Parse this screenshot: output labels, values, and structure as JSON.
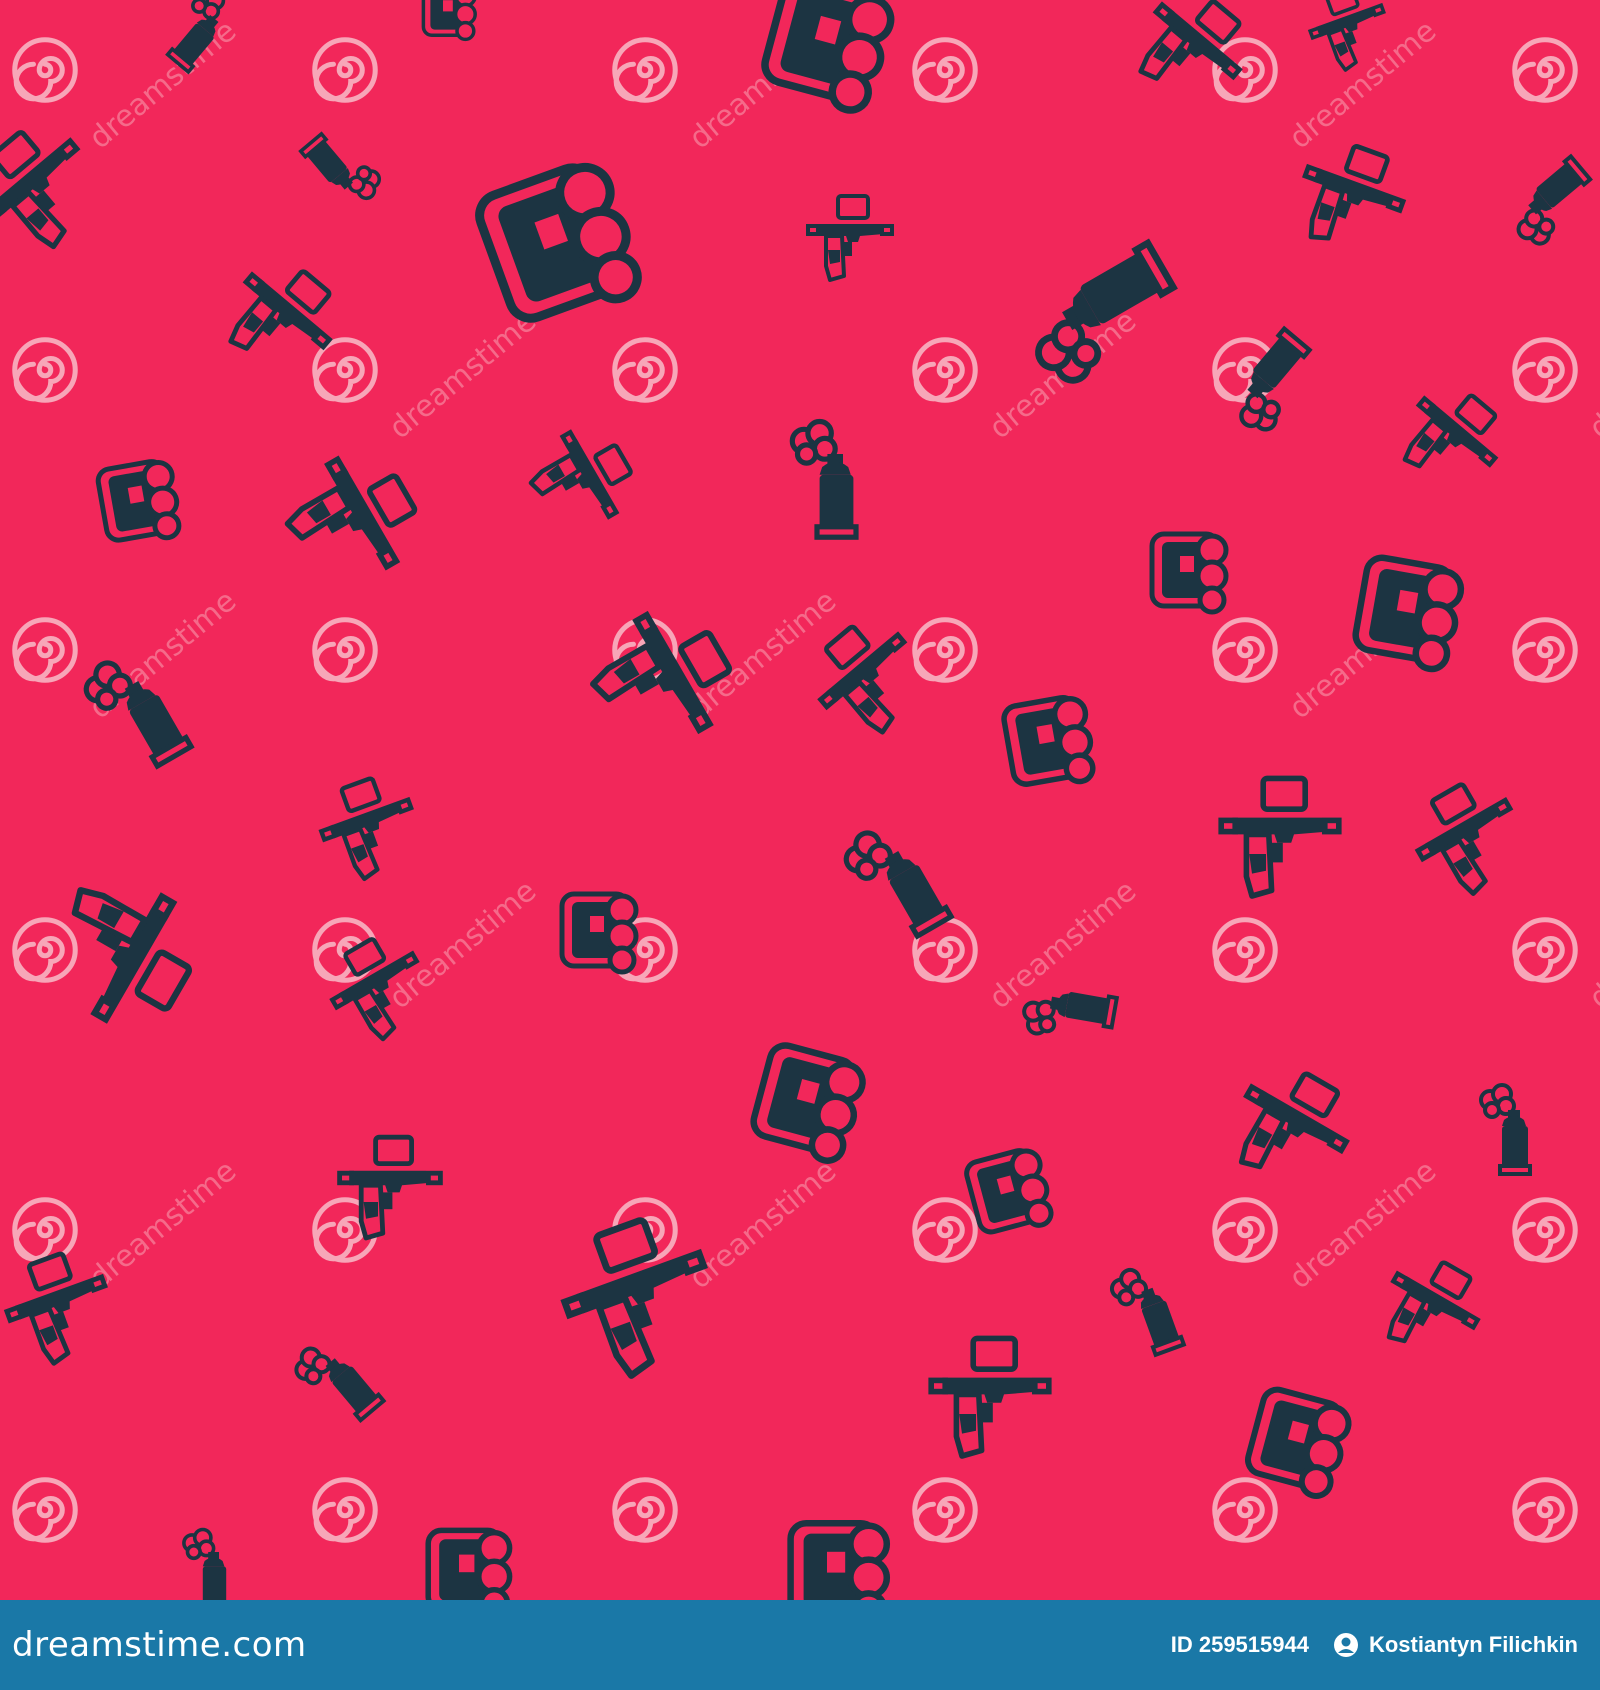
{
  "colors": {
    "background": "#f2275a",
    "icons": "#1c3442",
    "footer": "#1a78a7",
    "watermark_logo": "#f7a6b8",
    "watermark_text": "#f56a8a"
  },
  "watermark": {
    "logo_icon": "dreamstime-spiral-logo",
    "text": "dreamstime"
  },
  "icons": [
    "spray-paint-can-icon",
    "paint-spray-gun-icon",
    "paint-bucket-set-icon"
  ],
  "footer": {
    "brand": "dreamstime.com",
    "id_label": "ID 259515944",
    "author": "Kostiantyn Filichkin",
    "author_icon": "user-circle-icon"
  }
}
